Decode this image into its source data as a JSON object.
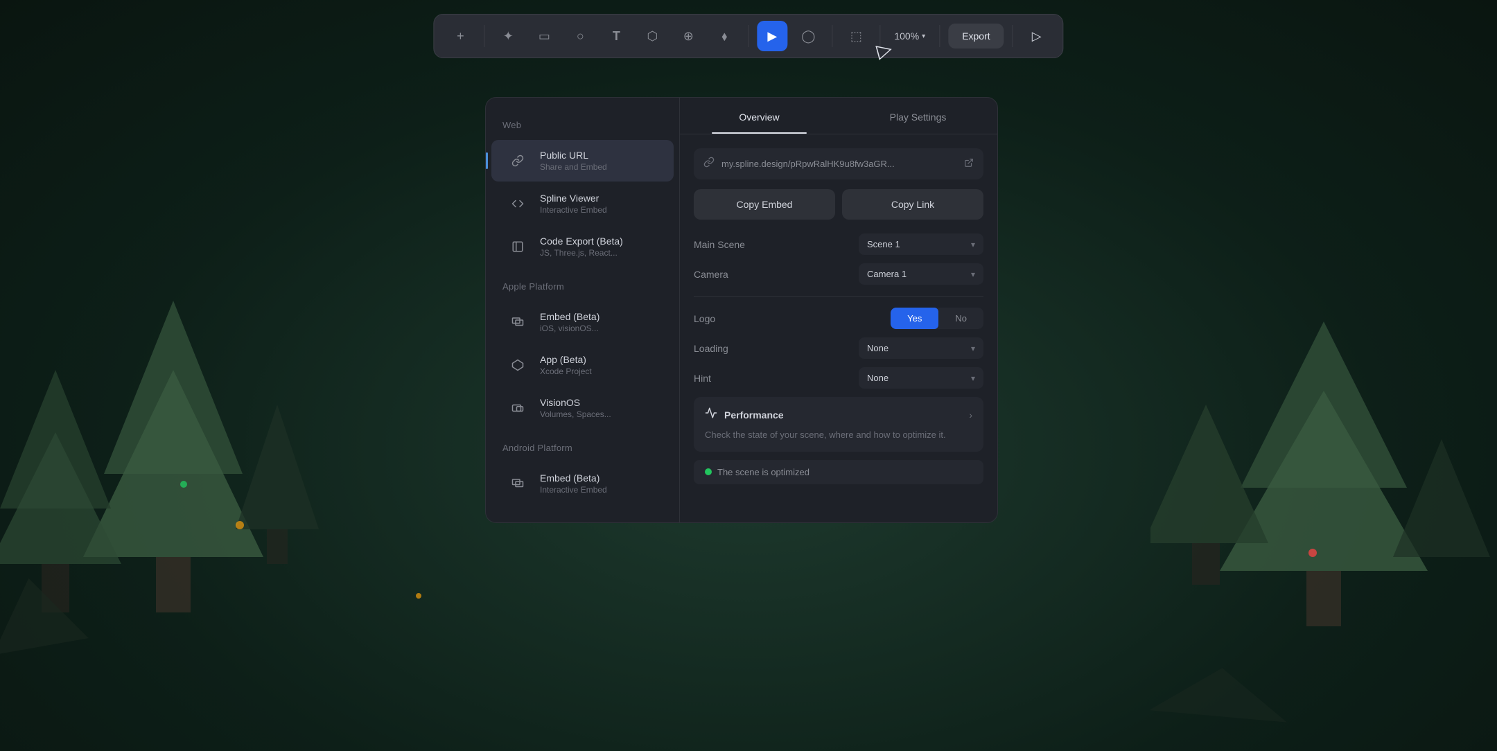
{
  "background": {
    "color": "#1a2a24"
  },
  "toolbar": {
    "zoom_label": "100%",
    "export_label": "Export",
    "tools": [
      {
        "name": "add",
        "icon": "+",
        "active": false
      },
      {
        "name": "magic",
        "icon": "✦",
        "active": false
      },
      {
        "name": "rectangle",
        "icon": "□",
        "active": false
      },
      {
        "name": "circle",
        "icon": "○",
        "active": false
      },
      {
        "name": "text",
        "icon": "T",
        "active": false
      },
      {
        "name": "3d-shape",
        "icon": "⬡",
        "active": false
      },
      {
        "name": "world",
        "icon": "⊕",
        "active": false
      },
      {
        "name": "tag",
        "icon": "⬧",
        "active": false
      },
      {
        "name": "pointer",
        "icon": "▶",
        "active": true
      },
      {
        "name": "comment",
        "icon": "◯",
        "active": false
      },
      {
        "name": "frame",
        "icon": "⬚",
        "active": false
      }
    ]
  },
  "sidebar": {
    "web_section_label": "Web",
    "items_web": [
      {
        "id": "public-url",
        "icon": "🔗",
        "title": "Public URL",
        "subtitle": "Share and Embed",
        "active": true
      },
      {
        "id": "spline-viewer",
        "icon": "</>",
        "title": "Spline Viewer",
        "subtitle": "Interactive Embed",
        "active": false
      },
      {
        "id": "code-export",
        "icon": "[ ]",
        "title": "Code Export (Beta)",
        "subtitle": "JS, Three.js, React...",
        "active": false
      }
    ],
    "apple_section_label": "Apple Platform",
    "items_apple": [
      {
        "id": "embed-beta-apple",
        "icon": "⊡",
        "title": "Embed (Beta)",
        "subtitle": "iOS, visionOS...",
        "active": false
      },
      {
        "id": "app-beta",
        "icon": "⬡",
        "title": "App (Beta)",
        "subtitle": "Xcode Project",
        "active": false
      },
      {
        "id": "visionos",
        "icon": "⊡",
        "title": "VisionOS",
        "subtitle": "Volumes, Spaces...",
        "active": false
      }
    ],
    "android_section_label": "Android Platform",
    "items_android": [
      {
        "id": "embed-beta-android",
        "icon": "⊡",
        "title": "Embed (Beta)",
        "subtitle": "Interactive Embed",
        "active": false
      }
    ]
  },
  "content": {
    "tab_overview": "Overview",
    "tab_play_settings": "Play Settings",
    "url": "my.spline.design/pRpwRalHK9u8fw3aGR...",
    "copy_embed_label": "Copy Embed",
    "copy_link_label": "Copy Link",
    "settings": {
      "main_scene_label": "Main Scene",
      "main_scene_value": "Scene 1",
      "camera_label": "Camera",
      "camera_value": "Camera 1",
      "logo_label": "Logo",
      "logo_yes": "Yes",
      "logo_no": "No",
      "loading_label": "Loading",
      "loading_value": "None",
      "hint_label": "Hint",
      "hint_value": "None"
    },
    "performance": {
      "title": "Performance",
      "description": "Check the state of your scene, where and how to optimize it.",
      "status": "The scene is optimized"
    }
  }
}
